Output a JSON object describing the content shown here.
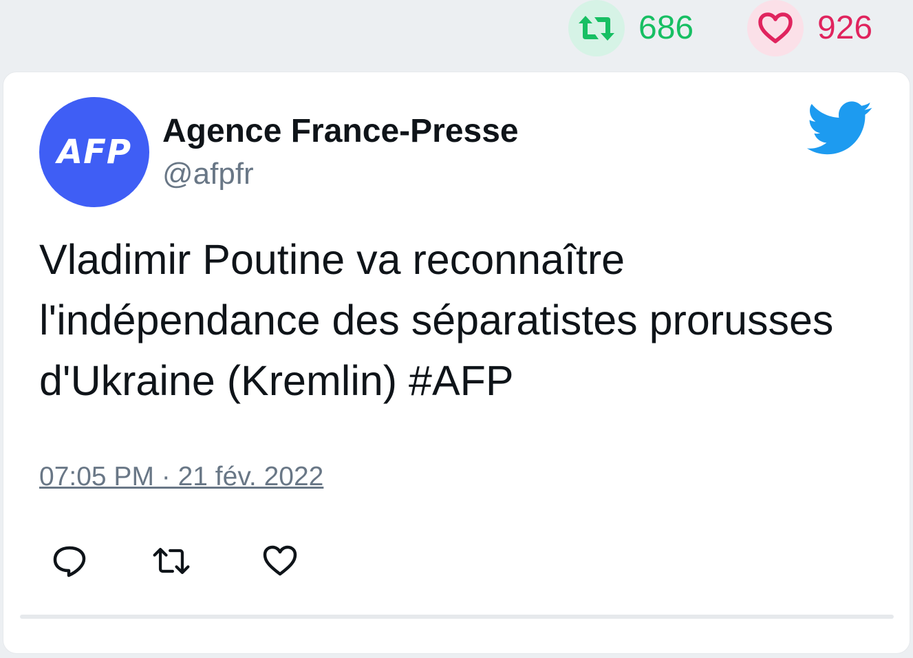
{
  "stats": {
    "retweets": "686",
    "likes": "926",
    "retweet_icon": "retweet-icon",
    "like_icon": "heart-icon",
    "retweet_color": "#17bf63",
    "like_color": "#e0245e"
  },
  "tweet": {
    "avatar_text": "AFP",
    "author_name": "Agence France-Presse",
    "author_handle": "@afpfr",
    "text": "Vladimir Poutine va reconnaître l'indépendance des séparatistes prorusses d'Ukraine (Kremlin) #AFP",
    "timestamp": "07:05 PM · 21 fév. 2022",
    "brand_icon": "twitter-bird-icon",
    "brand_color": "#1d9bf0",
    "avatar_color": "#3f5ef5"
  },
  "actions": {
    "reply_icon": "reply-icon",
    "retweet_icon": "retweet-icon",
    "like_icon": "heart-icon"
  }
}
